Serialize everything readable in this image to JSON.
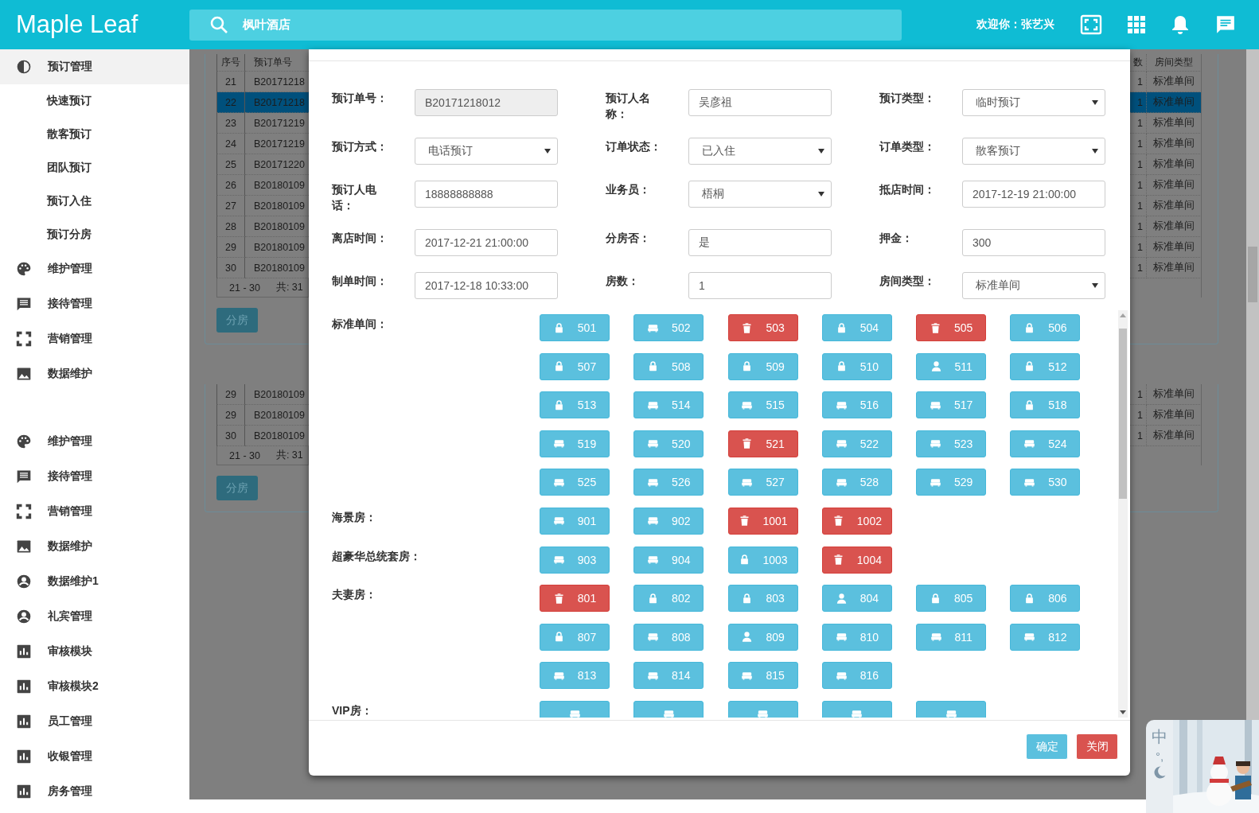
{
  "header": {
    "logo": "Maple Leaf",
    "search": {
      "value": "枫叶酒店"
    },
    "welcome": "欢迎你：张艺兴"
  },
  "sidebar": {
    "sections": [
      {
        "items": [
          {
            "label": "预订管理",
            "selected": true,
            "children": [
              {
                "label": "快速预订",
                "selected": false
              },
              {
                "label": "散客预订",
                "selected": false
              },
              {
                "label": "团队预订",
                "selected": false
              },
              {
                "label": "预订入住",
                "selected": false
              },
              {
                "label": "预订分房",
                "selected": false
              }
            ]
          },
          {
            "label": "维护管理",
            "selected": false
          },
          {
            "label": "接待管理",
            "selected": false
          },
          {
            "label": "营销管理",
            "selected": false
          },
          {
            "label": "数据维护",
            "selected": false
          }
        ]
      },
      {
        "items": [
          {
            "label": "维护管理",
            "selected": false
          },
          {
            "label": "接待管理",
            "selected": false
          },
          {
            "label": "营销管理",
            "selected": false
          },
          {
            "label": "数据维护",
            "selected": false
          },
          {
            "label": "数据维护1",
            "selected": false
          },
          {
            "label": "礼宾管理",
            "selected": false
          },
          {
            "label": "审核模块",
            "selected": false
          },
          {
            "label": "审核模块2",
            "selected": false
          },
          {
            "label": "员工管理",
            "selected": false
          },
          {
            "label": "收银管理",
            "selected": false
          },
          {
            "label": "房务管理",
            "selected": false
          }
        ]
      }
    ]
  },
  "background": {
    "panels": [
      {
        "columns": [
          "序号",
          "预订单号",
          "数",
          "房间类型"
        ],
        "rows": [
          {
            "cells": [
              "21",
              "B20171218",
              "1",
              "标准单间"
            ],
            "selected": false
          },
          {
            "cells": [
              "22",
              "B20171218",
              "1",
              "标准单间"
            ],
            "selected": true
          },
          {
            "cells": [
              "23",
              "B20171219",
              "1",
              "标准单间"
            ],
            "selected": false
          },
          {
            "cells": [
              "24",
              "B20171219",
              "1",
              "标准单间"
            ],
            "selected": false
          },
          {
            "cells": [
              "25",
              "B20171220",
              "1",
              "标准单间"
            ],
            "selected": false
          },
          {
            "cells": [
              "26",
              "B20180109",
              "1",
              "标准单间"
            ],
            "selected": false
          },
          {
            "cells": [
              "27",
              "B20180109",
              "1",
              "标准单间"
            ],
            "selected": false
          },
          {
            "cells": [
              "28",
              "B20180109",
              "1",
              "标准单间"
            ],
            "selected": false
          },
          {
            "cells": [
              "29",
              "B20180109",
              "1",
              "标准单间"
            ],
            "selected": false
          },
          {
            "cells": [
              "30",
              "B20180109",
              "1",
              "标准单间"
            ],
            "selected": false
          }
        ],
        "footer": {
          "range": "21 - 30",
          "total": "共: 31"
        },
        "button": "分房"
      },
      {
        "rows": [
          {
            "cells": [
              "29",
              "B20180109",
              "1",
              "标准单间"
            ],
            "selected": false
          },
          {
            "cells": [
              "29",
              "B20180109",
              "1",
              "标准单间"
            ],
            "selected": false
          },
          {
            "cells": [
              "30",
              "B20180109",
              "1",
              "标准单间"
            ],
            "selected": false
          }
        ],
        "footer": {
          "range": "21 - 30",
          "total": "共: 31"
        },
        "button": "分房"
      }
    ]
  },
  "modal": {
    "fields": [
      {
        "label": "预订单号：",
        "kind": "readonly",
        "value": "B20171218012"
      },
      {
        "label": "预订人名称：",
        "kind": "text",
        "value": "吴彦祖"
      },
      {
        "label": "预订类型：",
        "kind": "select",
        "value": "临时预订"
      },
      {
        "label": "预订方式：",
        "kind": "select",
        "value": "电话预订"
      },
      {
        "label": "订单状态：",
        "kind": "select",
        "value": "已入住"
      },
      {
        "label": "订单类型：",
        "kind": "select",
        "value": "散客预订"
      },
      {
        "label": "预订人电话：",
        "kind": "text",
        "value": "18888888888"
      },
      {
        "label": "业务员：",
        "kind": "select",
        "value": "梧桐"
      },
      {
        "label": "抵店时间：",
        "kind": "text",
        "value": "2017-12-19 21:00:00"
      },
      {
        "label": "离店时间：",
        "kind": "text",
        "value": "2017-12-21 21:00:00"
      },
      {
        "label": "分房否：",
        "kind": "text",
        "value": "是"
      },
      {
        "label": "押金：",
        "kind": "text",
        "value": "300"
      },
      {
        "label": "制单时间：",
        "kind": "text",
        "value": "2017-12-18 10:33:00"
      },
      {
        "label": "房数：",
        "kind": "text",
        "value": "1"
      },
      {
        "label": "房间类型：",
        "kind": "select",
        "value": "标准单间"
      }
    ],
    "room_groups": [
      {
        "name": "标准单间：",
        "rooms": [
          {
            "number": "501",
            "kind": "reserved"
          },
          {
            "number": "502",
            "kind": "vacant"
          },
          {
            "number": "503",
            "kind": "dirty"
          },
          {
            "number": "504",
            "kind": "reserved"
          },
          {
            "number": "505",
            "kind": "dirty"
          },
          {
            "number": "506",
            "kind": "reserved"
          },
          {
            "number": "507",
            "kind": "reserved"
          },
          {
            "number": "508",
            "kind": "reserved"
          },
          {
            "number": "509",
            "kind": "reserved"
          },
          {
            "number": "510",
            "kind": "reserved"
          },
          {
            "number": "511",
            "kind": "occupied"
          },
          {
            "number": "512",
            "kind": "reserved"
          },
          {
            "number": "513",
            "kind": "reserved"
          },
          {
            "number": "514",
            "kind": "vacant"
          },
          {
            "number": "515",
            "kind": "vacant"
          },
          {
            "number": "516",
            "kind": "vacant"
          },
          {
            "number": "517",
            "kind": "vacant"
          },
          {
            "number": "518",
            "kind": "reserved"
          },
          {
            "number": "519",
            "kind": "vacant"
          },
          {
            "number": "520",
            "kind": "vacant"
          },
          {
            "number": "521",
            "kind": "dirty"
          },
          {
            "number": "522",
            "kind": "vacant"
          },
          {
            "number": "523",
            "kind": "vacant"
          },
          {
            "number": "524",
            "kind": "vacant"
          },
          {
            "number": "525",
            "kind": "vacant"
          },
          {
            "number": "526",
            "kind": "vacant"
          },
          {
            "number": "527",
            "kind": "vacant"
          },
          {
            "number": "528",
            "kind": "vacant"
          },
          {
            "number": "529",
            "kind": "vacant"
          },
          {
            "number": "530",
            "kind": "vacant"
          }
        ]
      },
      {
        "name": "海景房：",
        "rooms": [
          {
            "number": "901",
            "kind": "vacant"
          },
          {
            "number": "902",
            "kind": "vacant"
          },
          {
            "number": "1001",
            "kind": "dirty"
          },
          {
            "number": "1002",
            "kind": "dirty"
          }
        ]
      },
      {
        "name": "超豪华总统套房：",
        "rooms": [
          {
            "number": "903",
            "kind": "vacant"
          },
          {
            "number": "904",
            "kind": "vacant"
          },
          {
            "number": "1003",
            "kind": "reserved"
          },
          {
            "number": "1004",
            "kind": "dirty"
          }
        ]
      },
      {
        "name": "夫妻房：",
        "rooms": [
          {
            "number": "801",
            "kind": "dirty"
          },
          {
            "number": "802",
            "kind": "reserved"
          },
          {
            "number": "803",
            "kind": "reserved"
          },
          {
            "number": "804",
            "kind": "occupied"
          },
          {
            "number": "805",
            "kind": "reserved"
          },
          {
            "number": "806",
            "kind": "reserved"
          },
          {
            "number": "807",
            "kind": "reserved"
          },
          {
            "number": "808",
            "kind": "vacant"
          },
          {
            "number": "809",
            "kind": "occupied"
          },
          {
            "number": "810",
            "kind": "vacant"
          },
          {
            "number": "811",
            "kind": "vacant"
          },
          {
            "number": "812",
            "kind": "vacant"
          },
          {
            "number": "813",
            "kind": "vacant"
          },
          {
            "number": "814",
            "kind": "vacant"
          },
          {
            "number": "815",
            "kind": "vacant"
          },
          {
            "number": "816",
            "kind": "vacant"
          }
        ]
      },
      {
        "name": "VIP房：",
        "rooms": [
          {
            "kind": "vacant"
          },
          {
            "kind": "vacant"
          },
          {
            "kind": "vacant"
          },
          {
            "kind": "vacant"
          },
          {
            "kind": "vacant"
          }
        ]
      }
    ],
    "buttons": [
      {
        "label": "确定",
        "kind": "primary"
      },
      {
        "label": "关闭",
        "kind": "danger"
      }
    ]
  },
  "ime": {
    "mode": "中",
    "punct": "°,"
  }
}
